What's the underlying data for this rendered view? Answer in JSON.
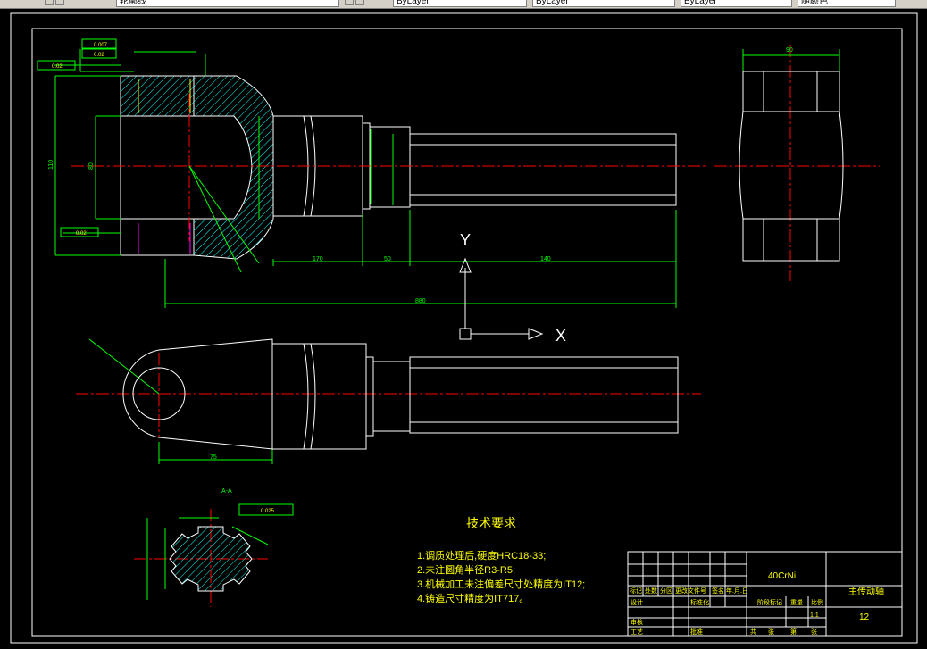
{
  "toolbar": {
    "linetype_value": "ByLayer",
    "lineweight_value": "ByLayer",
    "plotstyle_value": "ByLayer",
    "color_value": "随颜色",
    "layer_value": "轮廓线"
  },
  "drawing": {
    "tech_title": "技术要求",
    "notes": [
      "1.调质处理后,硬度HRC18-33;",
      "2.未注圆角半径R3-R5;",
      "3.机械加工未注偏差尺寸处精度为IT12;",
      "4.铸造尺寸精度为IT717。"
    ],
    "ucs": {
      "x_label": "X",
      "y_label": "Y"
    },
    "dims": {
      "overall_length": "880",
      "len_a": "170",
      "len_b": "50",
      "len_c": "140",
      "height_main": "110",
      "height_inner": "80",
      "width_right": "90",
      "bottom_len": "75",
      "gdt1": "0.007",
      "gdt2": "0.02",
      "gdt3": "0.02",
      "gdt4": "0.02",
      "section_label": "A-A",
      "section_gdt": "0.025"
    },
    "title_block": {
      "material": "40CrNi",
      "part_name": "主传动轴",
      "sheet_no": "12",
      "scale": "1:1",
      "row_labels": [
        "标记",
        "处数",
        "分区",
        "更改文件号",
        "签名",
        "年.月.日"
      ],
      "design": "设计",
      "standard": "标准化",
      "stage": "阶段标记",
      "weight": "重量",
      "ratio": "比例",
      "review": "审核",
      "craft": "工艺",
      "approve": "批准",
      "total": "共",
      "sheet": "张",
      "page": "第"
    }
  }
}
